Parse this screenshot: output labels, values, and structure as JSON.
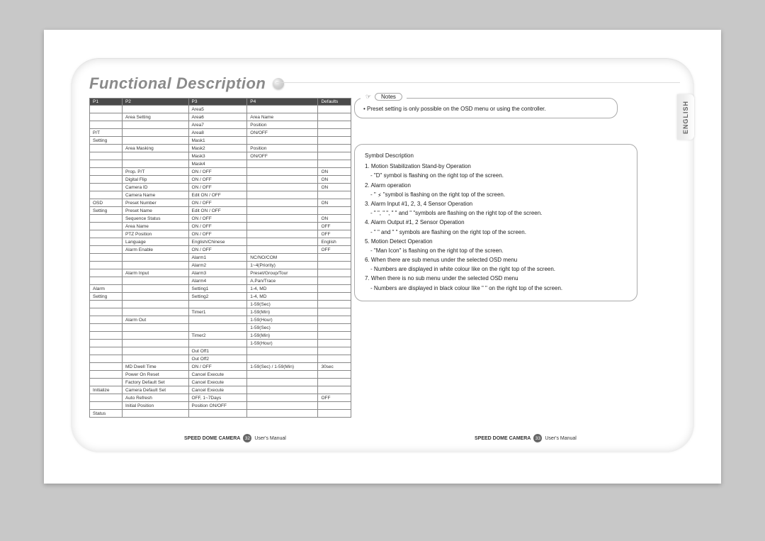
{
  "header": {
    "title": "Functional Description"
  },
  "side_tab": "ENGLISH",
  "table": {
    "headers": [
      "P1",
      "P2",
      "P3",
      "P4",
      "Defaults"
    ],
    "rows": [
      [
        "",
        "",
        "Area5",
        "",
        ""
      ],
      [
        "",
        "Area Setting",
        "Area6",
        "Area Name",
        ""
      ],
      [
        "",
        "",
        "Area7",
        "Position",
        ""
      ],
      [
        "P/T",
        "",
        "Area8",
        "ON/OFF",
        ""
      ],
      [
        "Setting",
        "",
        "Mask1",
        "",
        ""
      ],
      [
        "",
        "Area Masking",
        "Mask2",
        "Position",
        ""
      ],
      [
        "",
        "",
        "Mask3",
        "ON/OFF",
        ""
      ],
      [
        "",
        "",
        "Mask4",
        "",
        ""
      ],
      [
        "",
        "Prop. P/T",
        "ON / OFF",
        "",
        "ON"
      ],
      [
        "",
        "Digital Flip",
        "ON / OFF",
        "",
        "ON"
      ],
      [
        "",
        "Camera ID",
        "ON / OFF",
        "",
        "ON"
      ],
      [
        "",
        "Camera Name",
        "Edit    ON / OFF",
        "",
        ""
      ],
      [
        "OSD",
        "Preset Number",
        "ON / OFF",
        "",
        "ON"
      ],
      [
        "Setting",
        "Preset Name",
        "Edit    ON / OFF",
        "",
        ""
      ],
      [
        "",
        "Sequence Status",
        "ON / OFF",
        "",
        "ON"
      ],
      [
        "",
        "Area Name",
        "ON / OFF",
        "",
        "OFF"
      ],
      [
        "",
        "PTZ Position",
        "ON / OFF",
        "",
        "OFF"
      ],
      [
        "",
        "Language",
        "English/Chinese",
        "",
        "English"
      ],
      [
        "",
        "Alarm Enable",
        "ON / OFF",
        "",
        "OFF"
      ],
      [
        "",
        "",
        "Alarm1",
        "NC/NO/COM",
        ""
      ],
      [
        "",
        "",
        "Alarm2",
        "1~4(Priority)",
        ""
      ],
      [
        "",
        "Alarm Input",
        "Alarm3",
        "Preset/Group/Tour",
        ""
      ],
      [
        "",
        "",
        "Alarm4",
        "A.Pan/Trace",
        ""
      ],
      [
        "Alarm",
        "",
        "Setting1",
        "1-4, MD",
        ""
      ],
      [
        "Setting",
        "",
        "Setting2",
        "1-4, MD",
        ""
      ],
      [
        "",
        "",
        "",
        "1-59(Sec)",
        ""
      ],
      [
        "",
        "",
        "Timer1",
        "1-59(Min)",
        ""
      ],
      [
        "",
        "Alarm Out",
        "",
        "1-59(Hour)",
        ""
      ],
      [
        "",
        "",
        "",
        "1-59(Sec)",
        ""
      ],
      [
        "",
        "",
        "Timer2",
        "1-59(Min)",
        ""
      ],
      [
        "",
        "",
        "",
        "1-59(Hour)",
        ""
      ],
      [
        "",
        "",
        "Out Off1",
        "",
        ""
      ],
      [
        "",
        "",
        "Out Off2",
        "",
        ""
      ],
      [
        "",
        "MD Dwell Time",
        "ON / OFF",
        "1-59(Sec) / 1-59(Min)",
        "30sec"
      ],
      [
        "",
        "Power On Reset",
        "Cancel    Execute",
        "",
        ""
      ],
      [
        "",
        "Factory Default Set",
        "Cancel    Execute",
        "",
        ""
      ],
      [
        "Initialize",
        "Camera Default Set",
        "Cancel    Execute",
        "",
        ""
      ],
      [
        "",
        "Auto Refresh",
        "OFF, 1~7Days",
        "",
        "OFF"
      ],
      [
        "",
        "Initial Position",
        "Position    ON/OFF",
        "",
        ""
      ],
      [
        "Status",
        "",
        "",
        "",
        ""
      ]
    ]
  },
  "notes": {
    "label": "Notes",
    "bullet": "• Preset setting is only possible on the OSD menu or using the controller."
  },
  "symbol": {
    "title": "Symbol Description",
    "l1": "1. Motion Stabilization Stand-by Operation",
    "l1s": "- \"D\" symbol is flashing on the right top of the screen.",
    "l2": "2. Alarm operation",
    "l2s_pre": "- \" ",
    "l2s_post": " \"symbol is flashing on the right top of the screen.",
    "l3": "3. Alarm Input #1, 2, 3, 4 Sensor Operation",
    "l3s": "- \"    \", \"    \", \"    \" and \"    \"symbols are flashing on the right top of the screen.",
    "l4": "4. Alarm Output #1, 2 Sensor Operation",
    "l4s": "- \"    \" and \"    \" symbols are flashing on the right top of the screen.",
    "l5": "5. Motion Detect Operation",
    "l5s": "- \"Man Icon\" is flashing on the right top of the screen.",
    "l6": "6. When there are sub menus under the selected OSD menu",
    "l6s": "- Numbers are displayed in white colour like        on the right top of the screen.",
    "l7": "7. When there is no sub menu under the selected OSD menu",
    "l7s": "- Numbers are displayed in black colour like \"    \" on the right top of the screen."
  },
  "footer": {
    "product": "SPEED DOME CAMERA",
    "page_left": "32",
    "page_right": "33",
    "manual": "User's Manual"
  }
}
